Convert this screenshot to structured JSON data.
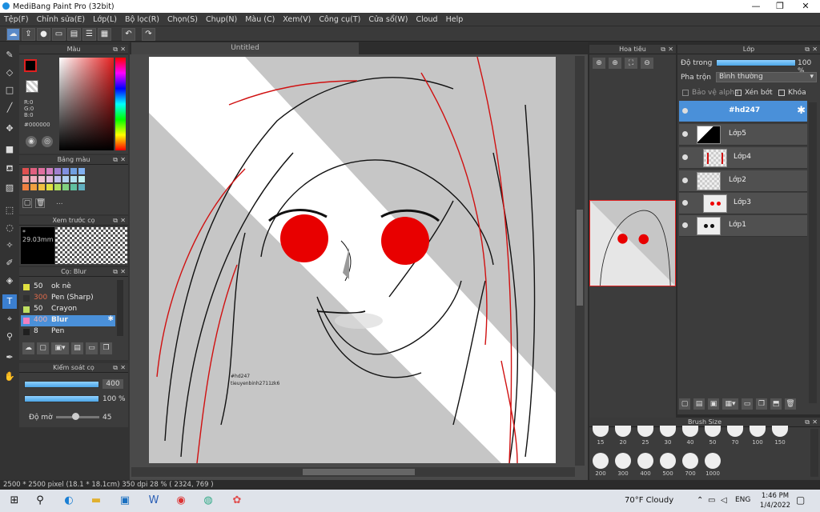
{
  "window": {
    "title": "MediBang Paint Pro (32bit)",
    "min": "—",
    "max": "❐",
    "close": "✕"
  },
  "menu": [
    "Tệp(F)",
    "Chỉnh sửa(E)",
    "Lớp(L)",
    "Bộ lọc(R)",
    "Chọn(S)",
    "Chụp(N)",
    "Màu (C)",
    "Xem(V)",
    "Công cụ(T)",
    "Cửa sổ(W)",
    "Cloud",
    "Help"
  ],
  "color_panel": {
    "title": "Màu",
    "r": "R:0",
    "g": "G:0",
    "b": "B:0",
    "hex": "#000000"
  },
  "palette_panel": {
    "title": "Bảng màu",
    "dots": "..."
  },
  "preview_panel": {
    "title": "Xem trước cọ",
    "size": "29.03mm"
  },
  "brush_panel": {
    "title": "Cọ: Blur",
    "brushes": [
      {
        "size": "50",
        "name": "ok nè",
        "color": "#e0e040"
      },
      {
        "size": "300",
        "name": "Pen (Sharp)",
        "color": "#303030"
      },
      {
        "size": "50",
        "name": "Crayon",
        "color": "#c0e060"
      },
      {
        "size": "400",
        "name": "Blur",
        "color": "#f080c0"
      },
      {
        "size": "8",
        "name": "Pen",
        "color": "#202020"
      }
    ]
  },
  "brush_control": {
    "title": "Kiểm soát cọ",
    "size": "400",
    "opacity": "100 %",
    "density_label": "Độ mờ",
    "density": "45",
    "size_level": 1.0,
    "opacity_level": 1.0,
    "density_level": 0.45
  },
  "canvas": {
    "tab": "Untitled",
    "signature1": "#hd247",
    "signature2": "tieuyenbinh2711zk6"
  },
  "navigator": {
    "title": "Hoa tiêu"
  },
  "layers": {
    "title": "Lớp",
    "opacity_label": "Độ trong",
    "opacity": "100 %",
    "blend_label": "Pha trộn",
    "blend": "Bình thường",
    "protect_alpha": "Bảo vệ alpha",
    "clipping": "Xén bớt",
    "lock": "Khóa",
    "items": [
      {
        "name": "#hd247",
        "selected": true
      },
      {
        "name": "Lớp5",
        "selected": false
      },
      {
        "name": "Lớp4",
        "selected": false
      },
      {
        "name": "Lớp2",
        "selected": false
      },
      {
        "name": "Lớp3",
        "selected": false
      },
      {
        "name": "Lớp1",
        "selected": false
      }
    ]
  },
  "brush_size": {
    "title": "Brush Size",
    "row1": [
      "15",
      "20",
      "25",
      "30",
      "40",
      "50",
      "70",
      "100",
      "150"
    ],
    "row2": [
      "200",
      "300",
      "400",
      "500",
      "700",
      "1000"
    ]
  },
  "status": {
    "text": "2500 * 2500 pixel  (18.1 * 18.1cm)  350 dpi   28 %  ( 2324, 769 )"
  },
  "taskbar": {
    "weather": "70°F  Cloudy",
    "lang": "ENG",
    "time": "1:46 PM",
    "date": "1/4/2022"
  }
}
